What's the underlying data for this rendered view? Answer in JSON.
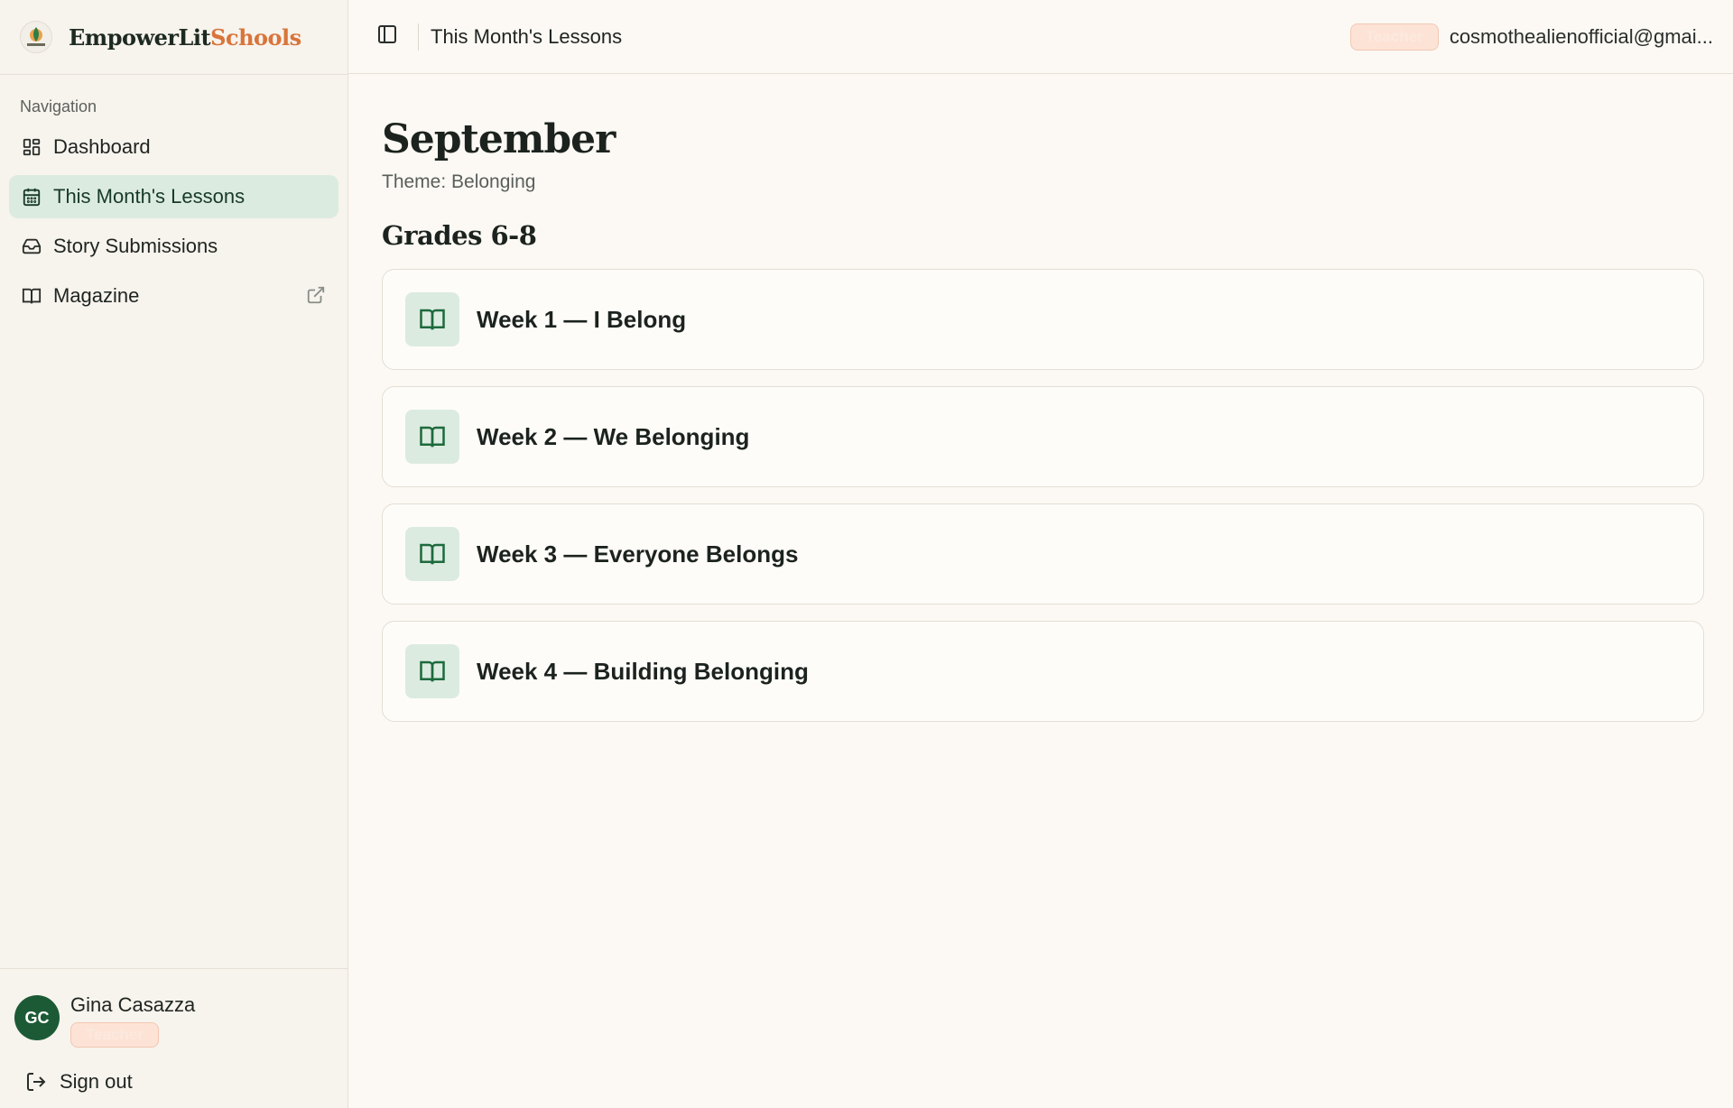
{
  "brand": {
    "name_part1": "EmpowerLit",
    "name_part2": "Schools"
  },
  "sidebar": {
    "section_label": "Navigation",
    "items": [
      {
        "label": "Dashboard",
        "icon": "dashboard-icon",
        "active": false
      },
      {
        "label": "This Month's Lessons",
        "icon": "calendar-icon",
        "active": true
      },
      {
        "label": "Story Submissions",
        "icon": "inbox-icon",
        "active": false
      },
      {
        "label": "Magazine",
        "icon": "book-icon",
        "active": false,
        "external": true
      }
    ]
  },
  "user": {
    "initials": "GC",
    "name": "Gina Casazza",
    "role": "Teacher"
  },
  "footer": {
    "signout_label": "Sign out"
  },
  "topbar": {
    "title": "This Month's Lessons",
    "role": "Teacher",
    "email": "cosmothealienofficial@gmai..."
  },
  "main": {
    "month": "September",
    "theme": "Theme: Belonging",
    "grade_heading": "Grades 6-8",
    "weeks": [
      {
        "label": "Week 1 — I Belong"
      },
      {
        "label": "Week 2 — We Belonging"
      },
      {
        "label": "Week 3 — Everyone Belongs"
      },
      {
        "label": "Week 4 — Building Belonging"
      }
    ]
  },
  "colors": {
    "accent_green": "#1b5a35",
    "active_bg": "#dcebe0",
    "brand_orange": "#d9743a",
    "badge_bg": "#fde3d6",
    "background": "#fcf9f4"
  }
}
